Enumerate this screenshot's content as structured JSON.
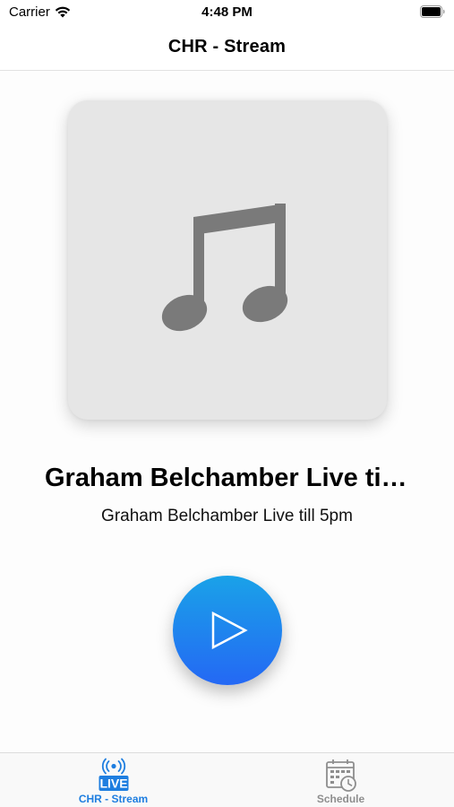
{
  "status_bar": {
    "carrier": "Carrier",
    "time": "4:48 PM",
    "icons": [
      "wifi-icon",
      "battery-icon"
    ]
  },
  "nav": {
    "title": "CHR - Stream"
  },
  "player": {
    "artwork_icon": "music-note-icon",
    "title": "Graham Belchamber Live till 5pm",
    "subtitle": "Graham Belchamber Live till 5pm",
    "play_icon": "play-icon"
  },
  "tab_bar": {
    "tabs": [
      {
        "label": "CHR - Stream",
        "icon": "live-broadcast-icon",
        "selected": true
      },
      {
        "label": "Schedule",
        "icon": "calendar-clock-icon",
        "selected": false
      }
    ]
  },
  "colors": {
    "accent": "#1e7ee0",
    "play_gradient_top": "#1aa2e8",
    "play_gradient_bottom": "#2468f4",
    "artwork_bg": "#e6e6e6",
    "note_color": "#7a7a7a",
    "tab_inactive": "#8e8e8e"
  }
}
